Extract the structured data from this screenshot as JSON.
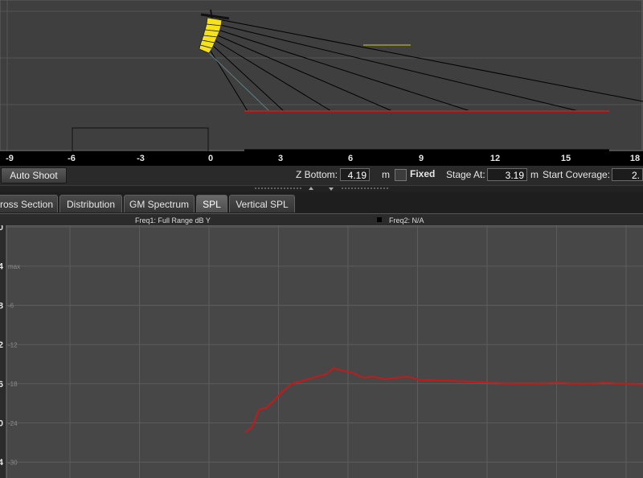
{
  "xsection": {
    "tick_labels": [
      "-9",
      "-6",
      "-3",
      "0",
      "3",
      "6",
      "9",
      "12",
      "15",
      "18"
    ]
  },
  "controls": {
    "auto_shoot": "Auto Shoot",
    "z_bottom_label": "Z Bottom:",
    "z_bottom_value": "4.19",
    "z_bottom_unit": "m",
    "fixed_label": "Fixed",
    "stage_at_label": "Stage At:",
    "stage_at_value": "3.19",
    "stage_at_unit": "m",
    "start_coverage_label": "Start Coverage:",
    "start_coverage_value": "2."
  },
  "tabs": [
    "ross Section",
    "Distribution",
    "GM Spectrum",
    "SPL",
    "Vertical SPL"
  ],
  "active_tab": "SPL",
  "legend": {
    "freq1": "Freq1: Full Range dB Y",
    "freq2": "Freq2: N/A"
  },
  "colors": {
    "speaker": "#f5e21a",
    "audience": "#c8181a",
    "spl_line": "#c41a1a",
    "rays": "#000000"
  },
  "chart_data": {
    "type": "line",
    "y_tick_labels": [
      "0",
      "4",
      "8",
      "2",
      "6",
      "0",
      "4"
    ],
    "y_inner_labels": [
      "max",
      "-6",
      "-12",
      "-18",
      "-24",
      "-30"
    ],
    "ylim": [
      -30,
      0
    ],
    "series": [
      {
        "values_xy": [
          [
            0.8,
            -25.5
          ],
          [
            1.1,
            -24.7
          ],
          [
            1.4,
            -22.0
          ],
          [
            1.7,
            -21.8
          ],
          [
            2.0,
            -20.8
          ],
          [
            2.4,
            -19.3
          ],
          [
            2.8,
            -18.1
          ],
          [
            3.3,
            -17.6
          ],
          [
            3.8,
            -17.1
          ],
          [
            4.3,
            -16.6
          ],
          [
            4.6,
            -15.7
          ],
          [
            5.0,
            -16.1
          ],
          [
            5.5,
            -16.5
          ],
          [
            5.9,
            -17.2
          ],
          [
            6.3,
            -17.0
          ],
          [
            6.8,
            -17.4
          ],
          [
            7.3,
            -17.2
          ],
          [
            7.8,
            -17.0
          ],
          [
            8.3,
            -17.5
          ],
          [
            9.3,
            -17.6
          ],
          [
            10.3,
            -17.7
          ],
          [
            11.3,
            -17.9
          ],
          [
            12.3,
            -18.0
          ],
          [
            13.3,
            -18.0
          ],
          [
            14.3,
            -17.9
          ],
          [
            15.3,
            -18.1
          ],
          [
            16.3,
            -17.9
          ],
          [
            17.3,
            -18.1
          ],
          [
            18.3,
            -18.3
          ],
          [
            19.3,
            -18.6
          ],
          [
            20.3,
            -19.0
          ]
        ]
      }
    ]
  }
}
